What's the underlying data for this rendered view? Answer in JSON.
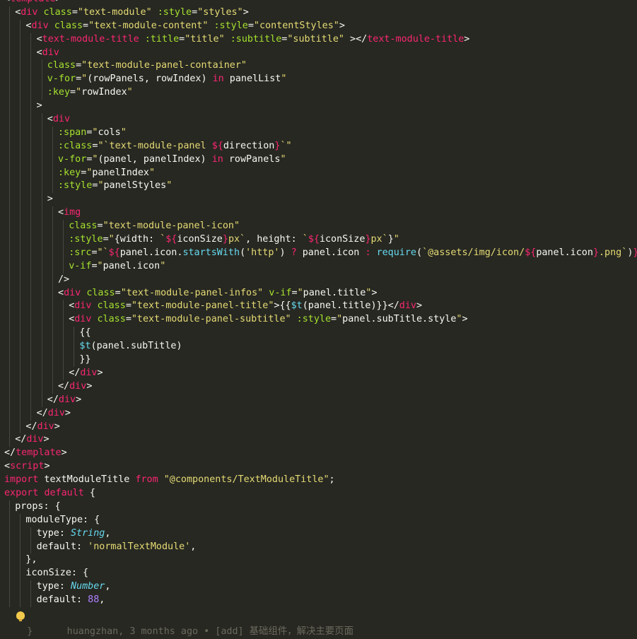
{
  "code_lines": [
    {
      "indent": 0,
      "tokens": [
        [
          "punc",
          "<"
        ],
        [
          "tag",
          "template"
        ],
        [
          "punc",
          ">"
        ]
      ]
    },
    {
      "indent": 1,
      "tokens": [
        [
          "punc",
          "<"
        ],
        [
          "tag",
          "div"
        ],
        [
          "plain",
          " "
        ],
        [
          "attr",
          "class"
        ],
        [
          "punc",
          "="
        ],
        [
          "str",
          "\"text-module\""
        ],
        [
          "plain",
          " "
        ],
        [
          "attr",
          ":style"
        ],
        [
          "punc",
          "="
        ],
        [
          "str",
          "\"styles\""
        ],
        [
          "punc",
          ">"
        ]
      ]
    },
    {
      "indent": 2,
      "tokens": [
        [
          "punc",
          "<"
        ],
        [
          "tag",
          "div"
        ],
        [
          "plain",
          " "
        ],
        [
          "attr",
          "class"
        ],
        [
          "punc",
          "="
        ],
        [
          "str",
          "\"text-module-content\""
        ],
        [
          "plain",
          " "
        ],
        [
          "attr",
          ":style"
        ],
        [
          "punc",
          "="
        ],
        [
          "str",
          "\"contentStyles\""
        ],
        [
          "punc",
          ">"
        ]
      ]
    },
    {
      "indent": 3,
      "tokens": [
        [
          "punc",
          "<"
        ],
        [
          "tag",
          "text-module-title"
        ],
        [
          "plain",
          " "
        ],
        [
          "attr",
          ":title"
        ],
        [
          "punc",
          "="
        ],
        [
          "str",
          "\"title\""
        ],
        [
          "plain",
          " "
        ],
        [
          "attr",
          ":subtitle"
        ],
        [
          "punc",
          "="
        ],
        [
          "str",
          "\"subtitle\""
        ],
        [
          "plain",
          " "
        ],
        [
          "punc",
          "></"
        ],
        [
          "tag",
          "text-module-title"
        ],
        [
          "punc",
          ">"
        ]
      ]
    },
    {
      "indent": 3,
      "tokens": [
        [
          "punc",
          "<"
        ],
        [
          "tag",
          "div"
        ]
      ]
    },
    {
      "indent": 4,
      "tokens": [
        [
          "attr",
          "class"
        ],
        [
          "punc",
          "="
        ],
        [
          "str",
          "\"text-module-panel-container\""
        ]
      ]
    },
    {
      "indent": 4,
      "tokens": [
        [
          "attr",
          "v-for"
        ],
        [
          "punc",
          "="
        ],
        [
          "str",
          "\""
        ],
        [
          "plain",
          "(rowPanels, rowIndex) "
        ],
        [
          "kw",
          "in"
        ],
        [
          "plain",
          " panelList"
        ],
        [
          "str",
          "\""
        ]
      ]
    },
    {
      "indent": 4,
      "tokens": [
        [
          "attr",
          ":key"
        ],
        [
          "punc",
          "="
        ],
        [
          "str",
          "\""
        ],
        [
          "plain",
          "rowIndex"
        ],
        [
          "str",
          "\""
        ]
      ]
    },
    {
      "indent": 3,
      "tokens": [
        [
          "punc",
          ">"
        ]
      ]
    },
    {
      "indent": 4,
      "tokens": [
        [
          "punc",
          "<"
        ],
        [
          "tag",
          "div"
        ]
      ]
    },
    {
      "indent": 5,
      "tokens": [
        [
          "attr",
          ":span"
        ],
        [
          "punc",
          "="
        ],
        [
          "str",
          "\""
        ],
        [
          "plain",
          "cols"
        ],
        [
          "str",
          "\""
        ]
      ]
    },
    {
      "indent": 5,
      "tokens": [
        [
          "attr",
          ":class"
        ],
        [
          "punc",
          "="
        ],
        [
          "str",
          "\"`text-module-panel "
        ],
        [
          "kw",
          "${"
        ],
        [
          "plain",
          "direction"
        ],
        [
          "kw",
          "}"
        ],
        [
          "str",
          "`\""
        ]
      ]
    },
    {
      "indent": 5,
      "tokens": [
        [
          "attr",
          "v-for"
        ],
        [
          "punc",
          "="
        ],
        [
          "str",
          "\""
        ],
        [
          "plain",
          "(panel, panelIndex) "
        ],
        [
          "kw",
          "in"
        ],
        [
          "plain",
          " rowPanels"
        ],
        [
          "str",
          "\""
        ]
      ]
    },
    {
      "indent": 5,
      "tokens": [
        [
          "attr",
          ":key"
        ],
        [
          "punc",
          "="
        ],
        [
          "str",
          "\""
        ],
        [
          "plain",
          "panelIndex"
        ],
        [
          "str",
          "\""
        ]
      ]
    },
    {
      "indent": 5,
      "tokens": [
        [
          "attr",
          ":style"
        ],
        [
          "punc",
          "="
        ],
        [
          "str",
          "\""
        ],
        [
          "plain",
          "panelStyles"
        ],
        [
          "str",
          "\""
        ]
      ]
    },
    {
      "indent": 4,
      "tokens": [
        [
          "punc",
          ">"
        ]
      ]
    },
    {
      "indent": 5,
      "tokens": [
        [
          "punc",
          "<"
        ],
        [
          "tag",
          "img"
        ]
      ]
    },
    {
      "indent": 6,
      "tokens": [
        [
          "attr",
          "class"
        ],
        [
          "punc",
          "="
        ],
        [
          "str",
          "\"text-module-panel-icon\""
        ]
      ]
    },
    {
      "indent": 6,
      "tokens": [
        [
          "attr",
          ":style"
        ],
        [
          "punc",
          "="
        ],
        [
          "str",
          "\""
        ],
        [
          "plain",
          "{width: "
        ],
        [
          "str",
          "`"
        ],
        [
          "kw",
          "${"
        ],
        [
          "plain",
          "iconSize"
        ],
        [
          "kw",
          "}"
        ],
        [
          "str",
          "px`"
        ],
        [
          "plain",
          ", height: "
        ],
        [
          "str",
          "`"
        ],
        [
          "kw",
          "${"
        ],
        [
          "plain",
          "iconSize"
        ],
        [
          "kw",
          "}"
        ],
        [
          "str",
          "px`"
        ],
        [
          "plain",
          "}"
        ],
        [
          "str",
          "\""
        ]
      ]
    },
    {
      "indent": 6,
      "tokens": [
        [
          "attr",
          ":src"
        ],
        [
          "punc",
          "="
        ],
        [
          "str",
          "\"`"
        ],
        [
          "kw",
          "${"
        ],
        [
          "plain",
          "panel.icon."
        ],
        [
          "fn",
          "startsWith"
        ],
        [
          "plain",
          "("
        ],
        [
          "str",
          "'http'"
        ],
        [
          "plain",
          ") "
        ],
        [
          "kw",
          "?"
        ],
        [
          "plain",
          " panel.icon "
        ],
        [
          "kw",
          ":"
        ],
        [
          "plain",
          " "
        ],
        [
          "fn",
          "require"
        ],
        [
          "plain",
          "("
        ],
        [
          "str",
          "`@assets/img/icon/"
        ],
        [
          "kw",
          "${"
        ],
        [
          "plain",
          "panel.icon"
        ],
        [
          "kw",
          "}"
        ],
        [
          "str",
          ".png`"
        ],
        [
          "plain",
          ")"
        ],
        [
          "kw",
          "}"
        ],
        [
          "str",
          "`\""
        ]
      ]
    },
    {
      "indent": 6,
      "tokens": [
        [
          "attr",
          "v-if"
        ],
        [
          "punc",
          "="
        ],
        [
          "str",
          "\""
        ],
        [
          "plain",
          "panel.icon"
        ],
        [
          "str",
          "\""
        ]
      ]
    },
    {
      "indent": 5,
      "tokens": [
        [
          "punc",
          "/>"
        ]
      ]
    },
    {
      "indent": 5,
      "tokens": [
        [
          "punc",
          "<"
        ],
        [
          "tag",
          "div"
        ],
        [
          "plain",
          " "
        ],
        [
          "attr",
          "class"
        ],
        [
          "punc",
          "="
        ],
        [
          "str",
          "\"text-module-panel-infos\""
        ],
        [
          "plain",
          " "
        ],
        [
          "attr",
          "v-if"
        ],
        [
          "punc",
          "="
        ],
        [
          "str",
          "\""
        ],
        [
          "plain",
          "panel.title"
        ],
        [
          "str",
          "\""
        ],
        [
          "punc",
          ">"
        ]
      ]
    },
    {
      "indent": 6,
      "tokens": [
        [
          "punc",
          "<"
        ],
        [
          "tag",
          "div"
        ],
        [
          "plain",
          " "
        ],
        [
          "attr",
          "class"
        ],
        [
          "punc",
          "="
        ],
        [
          "str",
          "\"text-module-panel-title\""
        ],
        [
          "punc",
          ">"
        ],
        [
          "plain",
          "{{"
        ],
        [
          "fn",
          "$t"
        ],
        [
          "plain",
          "(panel.title)}}"
        ],
        [
          "punc",
          "</"
        ],
        [
          "tag",
          "div"
        ],
        [
          "punc",
          ">"
        ]
      ]
    },
    {
      "indent": 6,
      "tokens": [
        [
          "punc",
          "<"
        ],
        [
          "tag",
          "div"
        ],
        [
          "plain",
          " "
        ],
        [
          "attr",
          "class"
        ],
        [
          "punc",
          "="
        ],
        [
          "str",
          "\"text-module-panel-subtitle\""
        ],
        [
          "plain",
          " "
        ],
        [
          "attr",
          ":style"
        ],
        [
          "punc",
          "="
        ],
        [
          "str",
          "\""
        ],
        [
          "plain",
          "panel.subTitle.style"
        ],
        [
          "str",
          "\""
        ],
        [
          "punc",
          ">"
        ]
      ]
    },
    {
      "indent": 7,
      "tokens": [
        [
          "plain",
          "{{"
        ]
      ]
    },
    {
      "indent": 7,
      "tokens": [
        [
          "fn",
          "$t"
        ],
        [
          "plain",
          "(panel.subTitle)"
        ]
      ]
    },
    {
      "indent": 7,
      "tokens": [
        [
          "plain",
          "}}"
        ]
      ]
    },
    {
      "indent": 6,
      "tokens": [
        [
          "punc",
          "</"
        ],
        [
          "tag",
          "div"
        ],
        [
          "punc",
          ">"
        ]
      ]
    },
    {
      "indent": 5,
      "tokens": [
        [
          "punc",
          "</"
        ],
        [
          "tag",
          "div"
        ],
        [
          "punc",
          ">"
        ]
      ]
    },
    {
      "indent": 4,
      "tokens": [
        [
          "punc",
          "</"
        ],
        [
          "tag",
          "div"
        ],
        [
          "punc",
          ">"
        ]
      ]
    },
    {
      "indent": 3,
      "tokens": [
        [
          "punc",
          "</"
        ],
        [
          "tag",
          "div"
        ],
        [
          "punc",
          ">"
        ]
      ]
    },
    {
      "indent": 2,
      "tokens": [
        [
          "punc",
          "</"
        ],
        [
          "tag",
          "div"
        ],
        [
          "punc",
          ">"
        ]
      ]
    },
    {
      "indent": 1,
      "tokens": [
        [
          "punc",
          "</"
        ],
        [
          "tag",
          "div"
        ],
        [
          "punc",
          ">"
        ]
      ]
    },
    {
      "indent": 0,
      "tokens": [
        [
          "punc",
          "</"
        ],
        [
          "tag",
          "template"
        ],
        [
          "punc",
          ">"
        ]
      ]
    },
    {
      "indent": 0,
      "tokens": [
        [
          "punc",
          "<"
        ],
        [
          "tag",
          "script"
        ],
        [
          "punc",
          ">"
        ]
      ]
    },
    {
      "indent": 0,
      "tokens": [
        [
          "kw",
          "import"
        ],
        [
          "plain",
          " textModuleTitle "
        ],
        [
          "kw",
          "from"
        ],
        [
          "plain",
          " "
        ],
        [
          "str",
          "\"@components/TextModuleTitle\""
        ],
        [
          "plain",
          ";"
        ]
      ]
    },
    {
      "indent": 0,
      "tokens": [
        [
          "kw",
          "export"
        ],
        [
          "plain",
          " "
        ],
        [
          "kw",
          "default"
        ],
        [
          "plain",
          " {"
        ]
      ]
    },
    {
      "indent": 1,
      "tokens": [
        [
          "plain",
          "props: "
        ],
        [
          "plain",
          "{"
        ]
      ]
    },
    {
      "indent": 2,
      "tokens": [
        [
          "plain",
          "moduleType: {"
        ]
      ]
    },
    {
      "indent": 3,
      "tokens": [
        [
          "plain",
          "type: "
        ],
        [
          "type",
          "String"
        ],
        [
          "plain",
          ","
        ]
      ]
    },
    {
      "indent": 3,
      "tokens": [
        [
          "plain",
          "default: "
        ],
        [
          "str",
          "'normalTextModule'"
        ],
        [
          "plain",
          ","
        ]
      ]
    },
    {
      "indent": 2,
      "tokens": [
        [
          "plain",
          "},"
        ]
      ]
    },
    {
      "indent": 2,
      "tokens": [
        [
          "plain",
          "iconSize: {"
        ]
      ]
    },
    {
      "indent": 3,
      "tokens": [
        [
          "plain",
          "type: "
        ],
        [
          "type",
          "Number"
        ],
        [
          "plain",
          ","
        ]
      ]
    },
    {
      "indent": 3,
      "tokens": [
        [
          "plain",
          "default: "
        ],
        [
          "num",
          "88"
        ],
        [
          "plain",
          ","
        ]
      ]
    }
  ],
  "blame_text": "  }      huangzhan, 3 months ago • [add] 基础组件，解决主要页面"
}
